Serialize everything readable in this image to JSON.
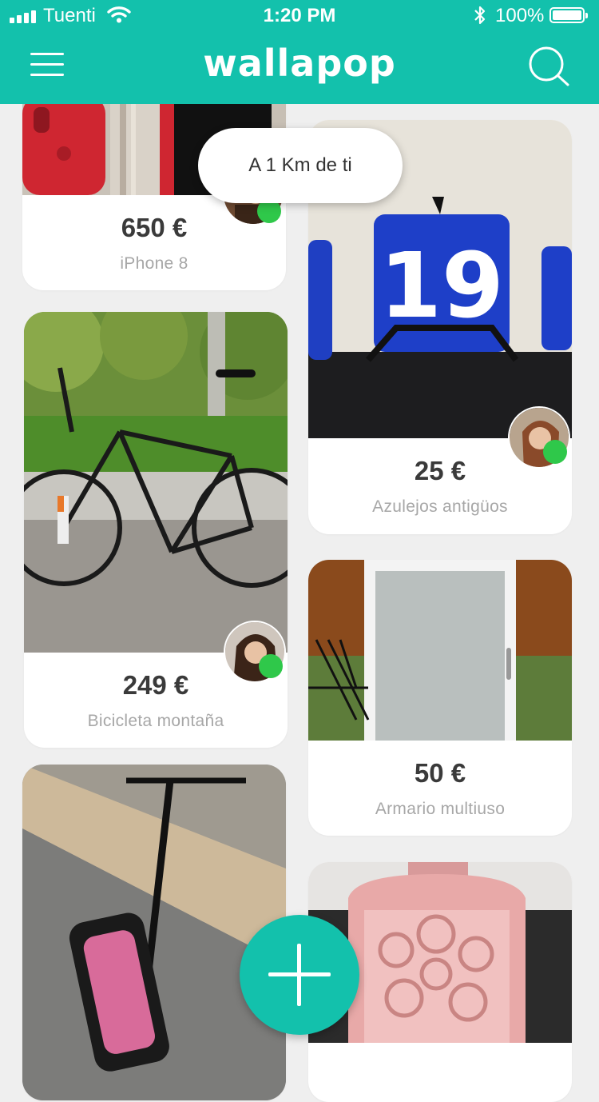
{
  "status_bar": {
    "carrier": "Tuenti",
    "time": "1:20 PM",
    "battery": "100%"
  },
  "nav": {
    "logo": "wallapop",
    "menu_icon": "hamburger-menu-icon",
    "search_icon": "search-icon"
  },
  "distance_pill": "A 1 Km de ti",
  "products": [
    {
      "price": "650 €",
      "title": "iPhone 8"
    },
    {
      "price": "249 €",
      "title": "Bicicleta montaña"
    },
    {
      "price": "",
      "title": ""
    },
    {
      "price": "25 €",
      "title": "Azulejos antigüos",
      "image_text": "19"
    },
    {
      "price": "50 €",
      "title": "Armario multiuso"
    },
    {
      "price": "",
      "title": ""
    }
  ],
  "colors": {
    "brand": "#13c1ac",
    "online": "#2fc84a",
    "background": "#efefef"
  },
  "fab_icon": "plus-icon"
}
